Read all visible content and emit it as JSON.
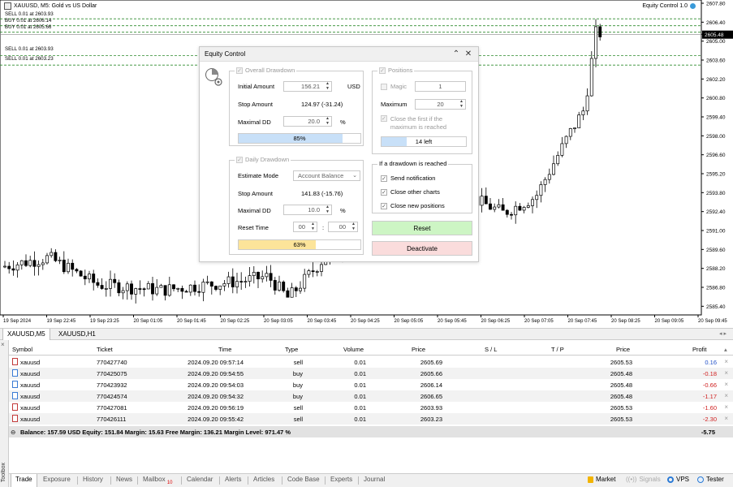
{
  "chart": {
    "title": "XAUUSD, M5:  Gold vs US Dollar",
    "ea_label": "Equity Control 1.0",
    "price_labels": [
      "2607.80",
      "2606.40",
      "2605.50",
      "2605.00",
      "2603.60",
      "2602.20",
      "2600.80",
      "2599.40",
      "2598.00",
      "2596.60",
      "2595.20",
      "2593.80",
      "2592.40",
      "2591.00",
      "2589.60",
      "2588.20",
      "2586.80",
      "2585.40"
    ],
    "current_price": "2605.48",
    "time_labels": [
      "19 Sep 2024",
      "19 Sep 22:45",
      "19 Sep 23:25",
      "20 Sep 01:05",
      "20 Sep 01:45",
      "20 Sep 02:25",
      "20 Sep 03:05",
      "20 Sep 03:45",
      "20 Sep 04:25",
      "20 Sep 05:05",
      "20 Sep 05:45",
      "20 Sep 06:25",
      "20 Sep 07:05",
      "20 Sep 07:45",
      "20 Sep 08:25",
      "20 Sep 09:05",
      "20 Sep 09:45"
    ],
    "order_lines": [
      {
        "label": "BUY 0.01 at 2606.65"
      },
      {
        "label": "BUY 0.01 at 2606.14"
      },
      {
        "label": "BUY 0.01 at 2605.66"
      },
      {
        "label": "SELL 0.01 at 2603.93"
      },
      {
        "label": "SELL 0.01 at 2603.23"
      }
    ],
    "colors": {
      "line": "#2e8b2e",
      "candle": "#000000",
      "bg": "#ffffff"
    }
  },
  "dialog": {
    "title": "Equity Control",
    "overall": {
      "legend": "Overall Drawdown",
      "initial_amount_label": "Initial Amount",
      "initial_amount_value": "156.21",
      "currency": "USD",
      "stop_amount_label": "Stop Amount",
      "stop_amount_value": "124.97 (-31.24)",
      "maximal_dd_label": "Maximal DD",
      "maximal_dd_value": "20.0",
      "percent": "%",
      "progress": 0.85,
      "progress_text": "85%",
      "progress_color": "#c8e0f8"
    },
    "daily": {
      "legend": "Daily Drawdown",
      "estimate_mode_label": "Estimate Mode",
      "estimate_mode_value": "Account Balance",
      "stop_amount_label": "Stop Amount",
      "stop_amount_value": "141.83 (-15.76)",
      "maximal_dd_label": "Maximal DD",
      "maximal_dd_value": "10.0",
      "percent": "%",
      "reset_time_label": "Reset Time",
      "reset_hour": "00",
      "reset_minute": "00",
      "separator": ":",
      "progress": 0.63,
      "progress_text": "63%",
      "progress_color": "#fce49a"
    },
    "positions": {
      "legend": "Positions",
      "magic_label": "Magic",
      "magic_value": "1",
      "maximum_label": "Maximum",
      "maximum_value": "20",
      "close_first_label": "Close the first if the maximum is reached",
      "progress": 0.3,
      "progress_text": "14 left",
      "progress_color": "#c8e0f8"
    },
    "drawdown_actions": {
      "legend": "If a drawdown is reached",
      "send_notification": "Send notification",
      "close_other_charts": "Close other charts",
      "close_new_positions": "Close new positions"
    },
    "reset_button": "Reset",
    "deactivate_button": "Deactivate",
    "reset_color": "#cdf5c4",
    "deactivate_color": "#fadcdc"
  },
  "chart_tabs": [
    "XAUUSD,M5",
    "XAUUSD,H1"
  ],
  "table": {
    "headers": [
      "Symbol",
      "Ticket",
      "Time",
      "Type",
      "Volume",
      "Price",
      "S / L",
      "T / P",
      "Price",
      "Profit"
    ],
    "rows": [
      {
        "symbol": "xauusd",
        "ticket": "770427740",
        "time": "2024.09.20 09:57:14",
        "type": "sell",
        "volume": "0.01",
        "price": "2605.69",
        "sl": "",
        "tp": "",
        "cur": "2605.53",
        "profit": "0.16"
      },
      {
        "symbol": "xauusd",
        "ticket": "770425075",
        "time": "2024.09.20 09:54:55",
        "type": "buy",
        "volume": "0.01",
        "price": "2605.66",
        "sl": "",
        "tp": "",
        "cur": "2605.48",
        "profit": "-0.18"
      },
      {
        "symbol": "xauusd",
        "ticket": "770423932",
        "time": "2024.09.20 09:54:03",
        "type": "buy",
        "volume": "0.01",
        "price": "2606.14",
        "sl": "",
        "tp": "",
        "cur": "2605.48",
        "profit": "-0.66"
      },
      {
        "symbol": "xauusd",
        "ticket": "770424574",
        "time": "2024.09.20 09:54:32",
        "type": "buy",
        "volume": "0.01",
        "price": "2606.65",
        "sl": "",
        "tp": "",
        "cur": "2605.48",
        "profit": "-1.17"
      },
      {
        "symbol": "xauusd",
        "ticket": "770427081",
        "time": "2024.09.20 09:56:19",
        "type": "sell",
        "volume": "0.01",
        "price": "2603.93",
        "sl": "",
        "tp": "",
        "cur": "2605.53",
        "profit": "-1.60"
      },
      {
        "symbol": "xauusd",
        "ticket": "770426111",
        "time": "2024.09.20 09:55:42",
        "type": "sell",
        "volume": "0.01",
        "price": "2603.23",
        "sl": "",
        "tp": "",
        "cur": "2605.53",
        "profit": "-2.30"
      }
    ],
    "balance_text": "Balance: 157.59 USD  Equity: 151.84  Margin: 15.63  Free Margin: 136.21  Margin Level: 971.47 %",
    "total_profit": "-5.75"
  },
  "toolbox_label": "Toolbox",
  "bottom_tabs": [
    "Trade",
    "Exposure",
    "History",
    "News",
    "Mailbox",
    "Calendar",
    "Alerts",
    "Articles",
    "Code Base",
    "Experts",
    "Journal"
  ],
  "mailbox_badge": "10",
  "right_tools": [
    "Market",
    "Signals",
    "VPS",
    "Tester"
  ]
}
